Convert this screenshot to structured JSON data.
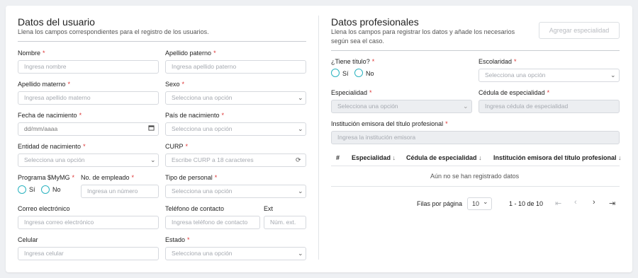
{
  "usuario": {
    "title": "Datos del usuario",
    "subtitle": "Llena los campos correspondientes para el registro de los usuarios.",
    "nombre_label": "Nombre",
    "nombre_ph": "Ingresa nombre",
    "apellido_paterno_label": "Apellido paterno",
    "apellido_paterno_ph": "Ingresa apellido paterno",
    "apellido_materno_label": "Apellido materno",
    "apellido_materno_ph": "Ingresa apellido materno",
    "sexo_label": "Sexo",
    "sexo_value": "Selecciona una opción",
    "fecha_label": "Fecha de nacimiento",
    "fecha_ph": "dd/mm/aaaa",
    "pais_label": "País de nacimiento",
    "pais_value": "Selecciona una opción",
    "entidad_label": "Entidad de nacimiento",
    "entidad_value": "Selecciona una opción",
    "curp_label": "CURP",
    "curp_ph": "Escribe CURP a 18 caracteres",
    "programa_label": "Programa $MyMG",
    "si_label": "Sí",
    "no_label": "No",
    "empleado_label": "No. de empleado",
    "empleado_ph": "Ingresa un número",
    "tipo_label": "Tipo de personal",
    "tipo_value": "Selecciona una opción",
    "correo_label": "Correo electrónico",
    "correo_ph": "Ingresa correo electrónico",
    "telefono_label": "Teléfono de contacto",
    "telefono_ph": "Ingresa teléfono de contacto",
    "ext_label": "Ext",
    "ext_ph": "Núm. ext.",
    "celular_label": "Celular",
    "celular_ph": "Ingresa celular",
    "estado_label": "Estado",
    "estado_value": "Selecciona una opción"
  },
  "profesional": {
    "title": "Datos profesionales",
    "subtitle_1": "Llena los campos para registrar los datos y añade los necesarios",
    "subtitle_2": "según sea el caso.",
    "add_button": "Agregar especialidad",
    "titulo_label": "¿Tiene título?",
    "si_label": "Sí",
    "no_label": "No",
    "escolaridad_label": "Escolaridad",
    "escolaridad_value": "Selecciona una opción",
    "especialidad_label": "Especialidad",
    "especialidad_value": "Selecciona una opción",
    "cedula_label": "Cédula de especialidad",
    "cedula_ph": "Ingresa cédula de especialidad",
    "institucion_label": "Institución emisora del título profesional",
    "institucion_ph": "Ingresa la institución emisora",
    "table": {
      "headers": [
        "#",
        "Especialidad",
        "Cédula de especialidad",
        "Institución emisora del título profesional"
      ],
      "empty": "Aún no se han registrado datos"
    },
    "pagination": {
      "rows_label": "Filas por página",
      "rows_value": "10",
      "range": "1 - 10 de 10"
    }
  },
  "icons": {
    "chevron": "chevron-down-icon",
    "calendar": "calendar-icon",
    "refresh": "refresh-icon",
    "sort": "arrow-down-icon",
    "first": "first-page-icon",
    "prev": "chevron-left-icon",
    "next": "chevron-right-icon",
    "last": "last-page-icon"
  },
  "colors": {
    "accent": "#2bb3c0",
    "required": "#dd3333"
  }
}
